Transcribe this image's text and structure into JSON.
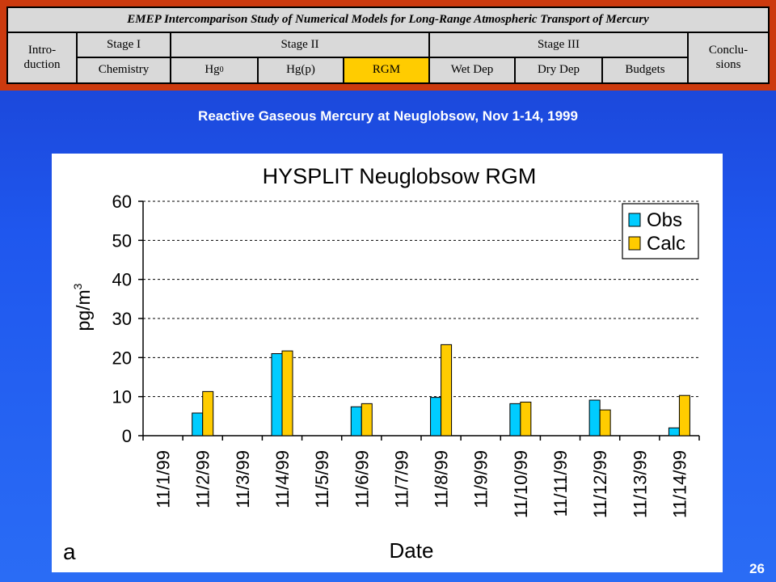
{
  "nav": {
    "title": "EMEP Intercomparison Study of Numerical Models for Long-Range Atmospheric Transport of Mercury",
    "intro": "Intro- duction",
    "stage1": "Stage I",
    "stage2": "Stage II",
    "stage3": "Stage III",
    "conclusions": "Conclu- sions",
    "chemistry": "Chemistry",
    "hg0_base": "Hg",
    "hg0_sup": "0",
    "hgp": "Hg(p)",
    "rgm": "RGM",
    "wetdep": "Wet Dep",
    "drydep": "Dry Dep",
    "budgets": "Budgets",
    "active_tab": "RGM",
    "colors": {
      "frame": "#cc3a0e",
      "cell": "#d9d9d9",
      "active": "#ffcc00"
    }
  },
  "slide_title": "Reactive Gaseous Mercury at Neuglobsow, Nov 1-14, 1999",
  "page_number": "26",
  "chart_data": {
    "type": "bar",
    "title": "HYSPLIT Neuglobsow RGM",
    "xlabel": "Date",
    "ylabel_base": "pg/m",
    "ylabel_sup": "3",
    "panel_label": "a",
    "categories": [
      "11/1/99",
      "11/2/99",
      "11/3/99",
      "11/4/99",
      "11/5/99",
      "11/6/99",
      "11/7/99",
      "11/8/99",
      "11/9/99",
      "11/10/99",
      "11/11/99",
      "11/12/99",
      "11/13/99",
      "11/14/99"
    ],
    "series": [
      {
        "name": "Obs",
        "color": "#00ccff",
        "values": [
          null,
          5.8,
          null,
          21,
          null,
          7.4,
          null,
          9.8,
          null,
          8.2,
          null,
          9.1,
          null,
          2.0
        ]
      },
      {
        "name": "Calc",
        "color": "#ffcc00",
        "values": [
          null,
          11.3,
          null,
          21.7,
          null,
          8.2,
          null,
          23.3,
          null,
          8.6,
          null,
          6.6,
          null,
          10.3
        ]
      }
    ],
    "ylim": [
      0,
      60
    ],
    "yticks": [
      0,
      10,
      20,
      30,
      40,
      50,
      60
    ],
    "grid": "dashed horizontal",
    "legend_position": "top-right"
  }
}
